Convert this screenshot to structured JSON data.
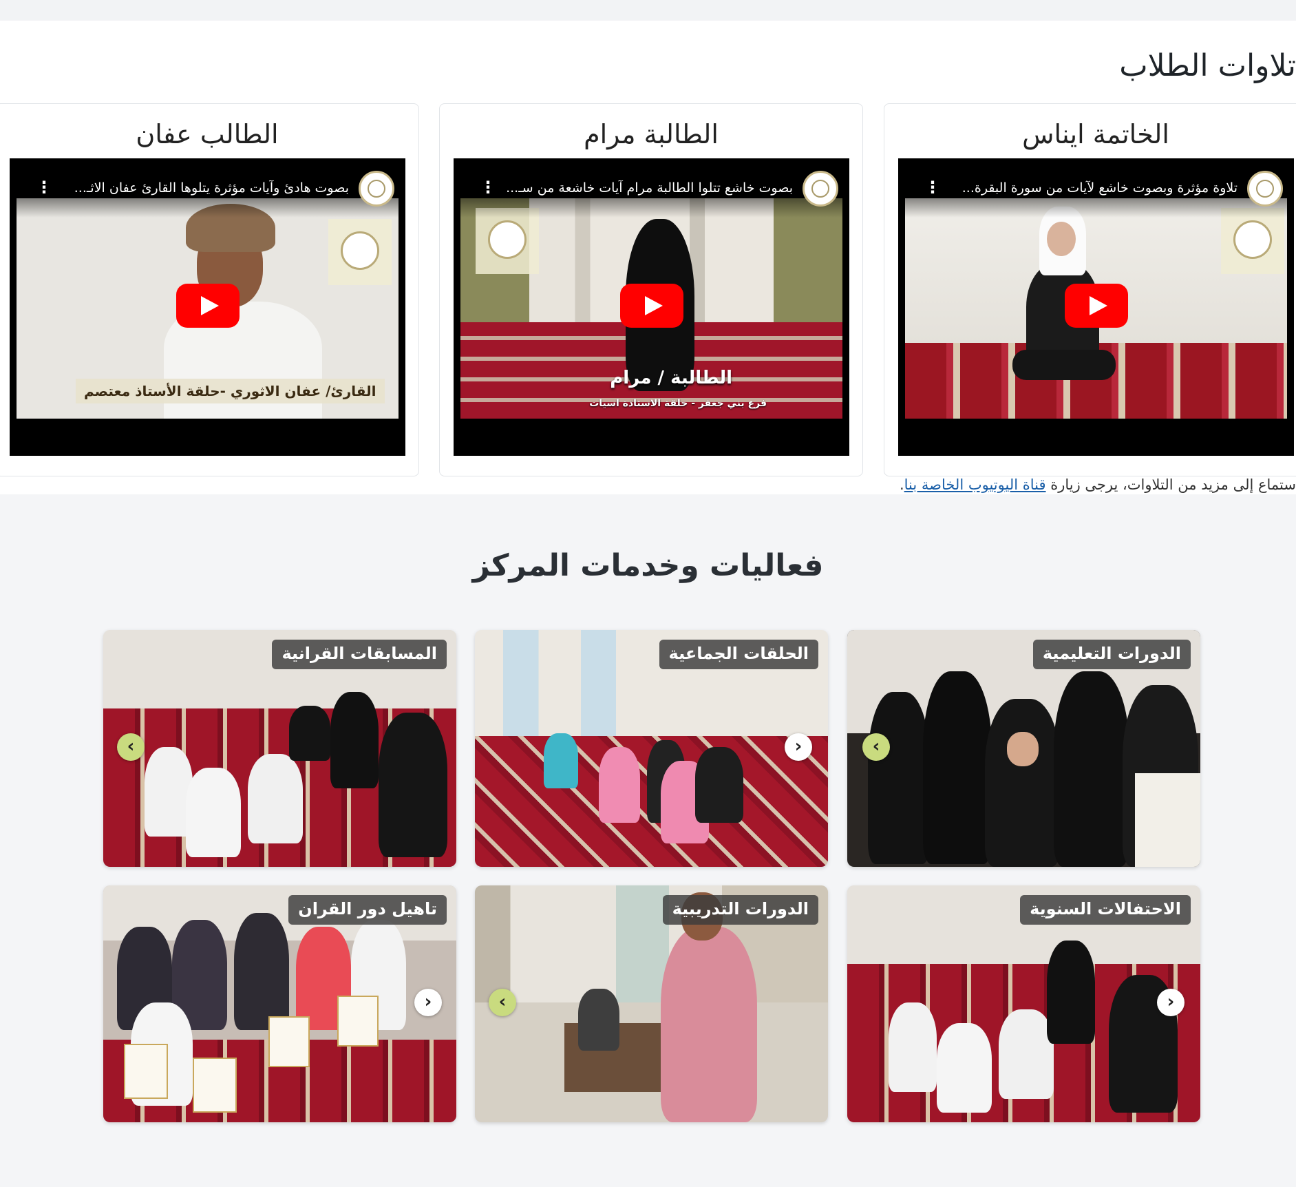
{
  "recitations": {
    "title": "تلاوات الطلاب",
    "cards": [
      {
        "title": "الخاتمة ايناس",
        "video_caption": "تلاوة مؤثرة وبصوت خاشع لآيات من سورة البقرة..."
      },
      {
        "title": "الطالبة مرام",
        "video_caption": "بصوت خاشع تتلوا الطالبة مرام آيات خاشعة من سـ...",
        "overlay_line1": "الطالبة / مرام",
        "overlay_line2": "فرع بني جعفر - حلقة الاستاذة اسيات"
      },
      {
        "title": "الطالب عفان",
        "video_caption": "بصوت هادئ وآيات مؤثرة يتلوها القارئ عفان الاثـ...",
        "overlay_line1": "القارئ/ عفان الاثوري -حلقة الأستاذ معتصم"
      }
    ],
    "note_prefix": "ستماع إلى مزيد من التلاوات، يرجى زيارة ",
    "note_link": "قناة اليوتيوب الخاصة بنا",
    "note_suffix": "."
  },
  "services": {
    "title": "فعاليات وخدمات المركز",
    "tiles": [
      {
        "label": "الدورات التعليمية"
      },
      {
        "label": "الحلقات الجماعية"
      },
      {
        "label": "المسابقات القرانية"
      },
      {
        "label": "الاحتفالات السنوية"
      },
      {
        "label": "الدورات التدريبية"
      },
      {
        "label": "تاهيل دور القران"
      }
    ]
  },
  "icons": {
    "play": "youtube-play-icon",
    "menu": "kebab-menu-icon",
    "arrow_prev": "chevron-left-icon",
    "arrow_next": "chevron-right-icon"
  },
  "colors": {
    "youtube_red": "#ff0000",
    "link_blue": "#1a5fa8",
    "carpet_red": "#9b1622",
    "arrow_green": "#c9db7f"
  }
}
